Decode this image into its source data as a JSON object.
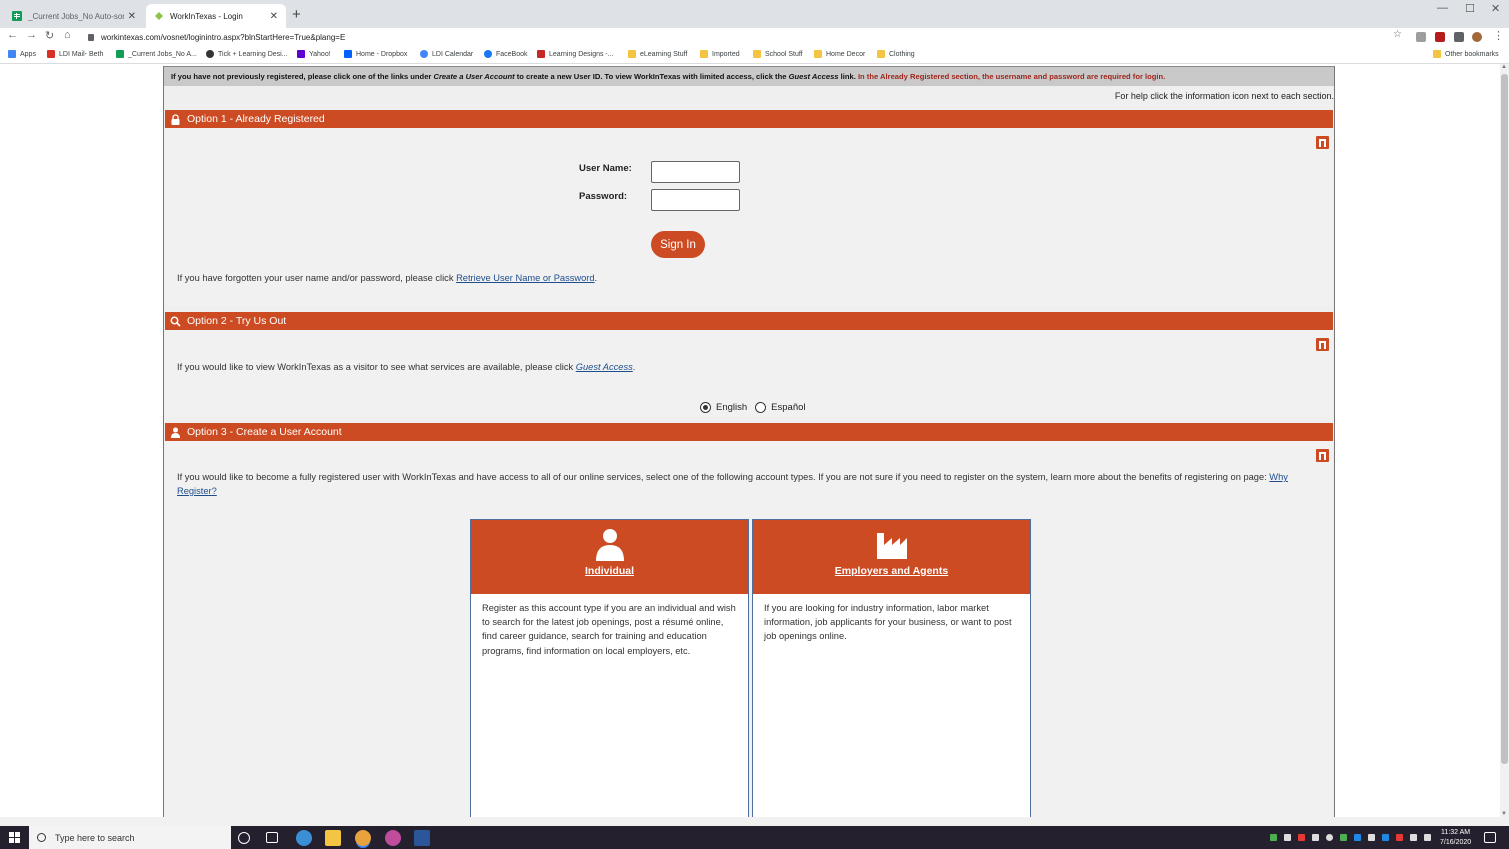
{
  "browser": {
    "tabs": [
      {
        "title": "_Current Jobs_No Auto-sort - Go",
        "active": false
      },
      {
        "title": "WorkInTexas - Login",
        "active": true
      }
    ],
    "new_tab_label": "+",
    "url": "workintexas.com/vosnet/loginintro.aspx?blnStartHere=True&plang=E",
    "bookmarks": [
      "Apps",
      "LDI Mail- Beth",
      "_Current Jobs_No A...",
      "Tick + Learning Desi...",
      "Yahoo!",
      "Home - Dropbox",
      "LDI Calendar",
      "FaceBook",
      "Learning Designs -...",
      "eLearning Stuff",
      "Imported",
      "School Stuff",
      "Home Decor",
      "Clothing"
    ],
    "other_bookmarks": "Other bookmarks"
  },
  "page": {
    "notice": {
      "part1": "If you have not previously registered, please click one of the links under ",
      "em1": "Create a User Account",
      "part2": " to create a new User ID. To view WorkInTexas with limited access, click the ",
      "em2": "Guest Access",
      "part3": " link. ",
      "red": "In the Already Registered section, the username and password are required for login."
    },
    "help_text": "For help click the information icon next to each section.",
    "option1": {
      "title": "Option 1 - Already Registered",
      "username_label": "User Name:",
      "password_label": "Password:",
      "signin_label": "Sign In",
      "forgot_text": "If you have forgotten your user name and/or password, please click ",
      "forgot_link": "Retrieve User Name or Password",
      "forgot_end": "."
    },
    "option2": {
      "title": "Option 2 - Try Us Out",
      "text": "If you would like to view WorkInTexas as a visitor to see what services are available, please click ",
      "link": "Guest Access",
      "end": ".",
      "lang_english": "English",
      "lang_espanol": "Español",
      "selected": "English"
    },
    "option3": {
      "title": "Option 3 - Create a User Account",
      "text": "If you would like to become a fully registered user with WorkInTexas and have access to all of our online services, select one of the following account types. If you are not sure if you need to register on the system, learn more about the benefits of registering on page: ",
      "link": "Why Register?",
      "cards": [
        {
          "title": "Individual",
          "desc": "Register as this account type if you are an individual and wish to search for the latest job openings, post a résumé online, find career guidance, search for training and education programs, find information on local employers, etc."
        },
        {
          "title": "Employers and Agents",
          "desc": "If you are looking for industry information, labor market information, job applicants for your business, or want to post job openings online."
        }
      ]
    }
  },
  "taskbar": {
    "search_placeholder": "Type here to search",
    "time": "11:32 AM",
    "date": "7/16/2020"
  },
  "colors": {
    "accent": "#cc4b22",
    "link": "#1f4e8c",
    "notice_red": "#a0261c"
  }
}
